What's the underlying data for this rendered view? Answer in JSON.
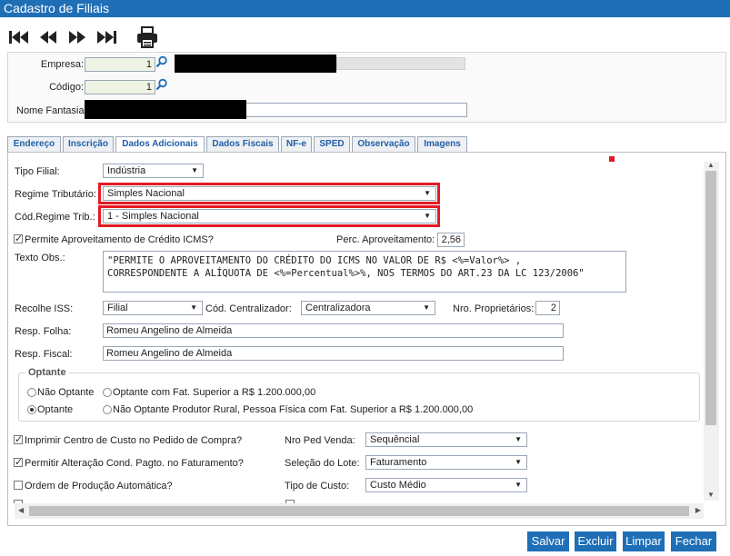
{
  "window": {
    "title": "Cadastro de Filiais"
  },
  "toolbar": {
    "icons": [
      "first-record-icon",
      "previous-record-icon",
      "next-record-icon",
      "last-record-icon",
      "print-icon"
    ]
  },
  "header": {
    "empresa_label": "Empresa:",
    "empresa_value": "1",
    "codigo_label": "Código:",
    "codigo_value": "1",
    "nome_fantasia_label": "Nome Fantasia"
  },
  "tabs": [
    "Endereço",
    "Inscrição",
    "Dados Adicionais",
    "Dados Fiscais",
    "NF-e",
    "SPED",
    "Observação",
    "Imagens"
  ],
  "active_tab": "Dados Adicionais",
  "form": {
    "tipo_filial_label": "Tipo Filial:",
    "tipo_filial_value": "Indústria",
    "regime_label": "Regime Tributário:",
    "regime_value": "Simples Nacional",
    "cod_regime_label": "Cód.Regime Trib.:",
    "cod_regime_value": "1 - Simples Nacional",
    "permite_label": "Permite Aproveitamento de Crédito ICMS?",
    "perc_label": "Perc. Aproveitamento:",
    "perc_value": "2,56",
    "texto_obs_label": "Texto Obs.:",
    "texto_obs_value": "\"PERMITE O APROVEITAMENTO DO CRÉDITO DO ICMS NO VALOR DE R$ <%=Valor%> ,\nCORRESPONDENTE A ALÍQUOTA DE <%=Percentual%>%, NOS TERMOS DO ART.23 DA LC 123/2006\"",
    "recolhe_iss_label": "Recolhe ISS:",
    "recolhe_iss_value": "Filial",
    "cod_centralizador_label": "Cód. Centralizador:",
    "cod_centralizador_value": "Centralizadora",
    "nro_proprietarios_label": "Nro. Proprietários:",
    "nro_proprietarios_value": "2",
    "resp_folha_label": "Resp. Folha:",
    "resp_folha_value": "Romeu Angelino de Almeida",
    "resp_fiscal_label": "Resp. Fiscal:",
    "resp_fiscal_value": "Romeu Angelino de Almeida",
    "optante_legend": "Optante",
    "radio_nao_optante": "Não Optante",
    "radio_optante_fat": "Optante com Fat. Superior a R$ 1.200.000,00",
    "radio_optante": "Optante",
    "radio_nao_optante_rural": "Não Optante Produtor Rural, Pessoa Física com Fat. Superior a R$ 1.200.000,00",
    "imprimir_centro_label": "Imprimir Centro de Custo no Pedido de Compra?",
    "permitir_alteracao_label": "Permitir Alteração Cond. Pagto. no Faturamento?",
    "ordem_producao_label": "Ordem de Produção Automática?",
    "nro_ped_venda_label": "Nro Ped Venda:",
    "nro_ped_venda_value": "Sequêncial",
    "selecao_lote_label": "Seleção do Lote:",
    "selecao_lote_value": "Faturamento",
    "tipo_custo_label": "Tipo de Custo:",
    "tipo_custo_value": "Custo Médio"
  },
  "buttons": {
    "salvar": "Salvar",
    "excluir": "Excluir",
    "limpar": "Limpar",
    "fechar": "Fechar"
  },
  "colors": {
    "title_bar": "#1f6fb6",
    "highlight": "#e41b23",
    "button": "#1f6fb6"
  }
}
